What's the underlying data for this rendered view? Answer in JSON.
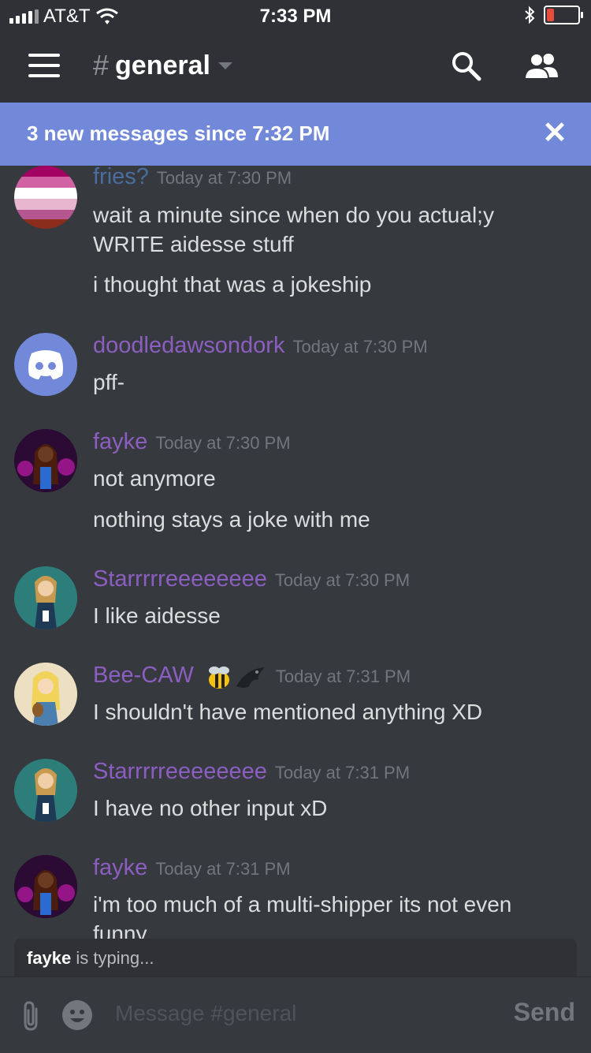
{
  "status_bar": {
    "carrier": "AT&T",
    "time": "7:33 PM"
  },
  "header": {
    "channel_hash": "#",
    "channel_name": "general"
  },
  "banner": {
    "text": "3 new messages since 7:32 PM",
    "close": "✕"
  },
  "messages": [
    {
      "author": "fries?",
      "timestamp": "Today at 7:30 PM",
      "lines": [
        "wait a minute since when do you actual;y WRITE aidesse stuff",
        "i thought that was a jokeship"
      ]
    },
    {
      "author": "doodledawsondork",
      "timestamp": "Today at 7:30 PM",
      "lines": [
        "pff-"
      ]
    },
    {
      "author": "fayke",
      "timestamp": "Today at 7:30 PM",
      "lines": [
        "not anymore",
        "nothing stays a joke with me"
      ]
    },
    {
      "author": "Starrrrreeeeeeee",
      "timestamp": "Today at 7:30 PM",
      "lines": [
        "I like aidesse"
      ]
    },
    {
      "author": "Bee-CAW",
      "timestamp": "Today at 7:31 PM",
      "lines": [
        "I shouldn't have mentioned anything XD"
      ]
    },
    {
      "author": "Starrrrreeeeeeee",
      "timestamp": "Today at 7:31 PM",
      "lines": [
        "I have no other input xD"
      ]
    },
    {
      "author": "fayke",
      "timestamp": "Today at 7:31 PM",
      "lines": [
        "i'm too much of a multi-shipper its not even funny"
      ]
    }
  ],
  "typing": {
    "user": "fayke",
    "suffix": " is typing..."
  },
  "composer": {
    "placeholder": "Message #general",
    "send_label": "Send"
  }
}
